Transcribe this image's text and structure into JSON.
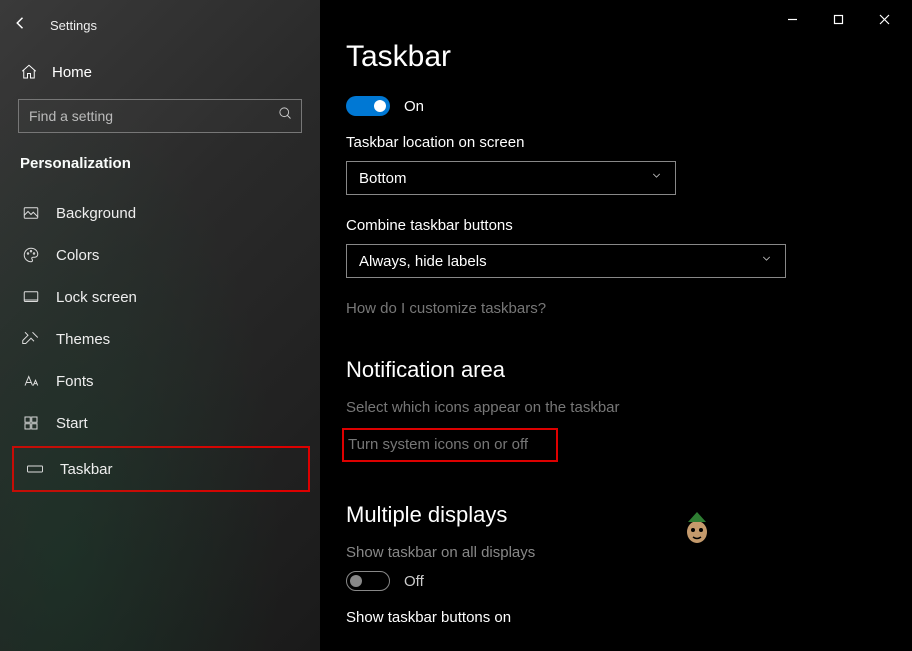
{
  "app": {
    "title": "Settings"
  },
  "sidebar": {
    "home": "Home",
    "search_placeholder": "Find a setting",
    "section": "Personalization",
    "items": [
      {
        "label": "Background"
      },
      {
        "label": "Colors"
      },
      {
        "label": "Lock screen"
      },
      {
        "label": "Themes"
      },
      {
        "label": "Fonts"
      },
      {
        "label": "Start"
      },
      {
        "label": "Taskbar"
      }
    ]
  },
  "main": {
    "title": "Taskbar",
    "toggle_on_label": "On",
    "location_label": "Taskbar location on screen",
    "location_value": "Bottom",
    "combine_label": "Combine taskbar buttons",
    "combine_value": "Always, hide labels",
    "customize_link": "How do I customize taskbars?",
    "notification_title": "Notification area",
    "notification_link1": "Select which icons appear on the taskbar",
    "notification_link2": "Turn system icons on or off",
    "multi_title": "Multiple displays",
    "multi_desc": "Show taskbar on all displays",
    "toggle_off_label": "Off",
    "multi_buttons_label": "Show taskbar buttons on"
  }
}
